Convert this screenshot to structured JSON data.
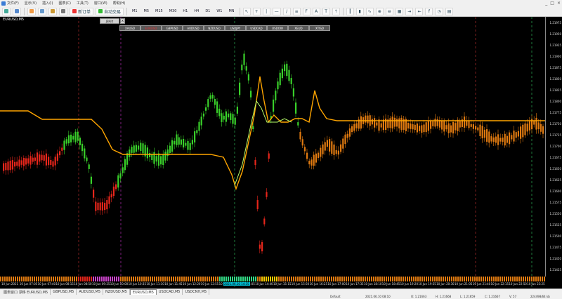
{
  "menu": {
    "items": [
      "文件(F)",
      "显示(V)",
      "插入(I)",
      "图表(C)",
      "工具(T)",
      "窗口(W)",
      "帮助(H)"
    ],
    "window_controls": [
      "_",
      "□",
      "×"
    ]
  },
  "toolbar": {
    "new_order_label": "新订单",
    "auto_trading_label": "自动交易",
    "timeframes": [
      "M1",
      "M5",
      "M15",
      "M30",
      "H1",
      "H4",
      "D1",
      "W1",
      "MN"
    ]
  },
  "chart": {
    "title": "EURUSD,M5",
    "symbol_tab": "JBAllt",
    "symbol_close": "x",
    "symbols": [
      "XAUSD",
      "EURUSD",
      "GBPUSD",
      "AUDUSD",
      "NZDUSD",
      "USDJPY",
      "USDCAD",
      "USDOW",
      "XEUD",
      "XTISD"
    ],
    "active_symbol": "EURUSD",
    "price_labels": [
      "1.21975",
      "1.21950",
      "1.21925",
      "1.21900",
      "1.21875",
      "1.21850",
      "1.21825",
      "1.21800",
      "1.21775",
      "1.21750",
      "1.21725",
      "1.21700",
      "1.21675",
      "1.21650",
      "1.21625",
      "1.21600",
      "1.21575",
      "1.21550",
      "1.21525",
      "1.21500",
      "1.21475",
      "1.21450",
      "1.21425"
    ],
    "time_labels": [
      "10 Jun 2021",
      "10 Jun 07:05",
      "10 Jun 07:40",
      "10 Jun 08:15",
      "10 Jun 08:50",
      "10 Jun 09:25",
      "10 Jun 10:00",
      "10 Jun 10:35",
      "10 Jun 11:10",
      "10 Jun 11:45",
      "10 Jun 12:20",
      "10 Jun 12:55",
      "10 Jun 13:30",
      "10 Jun 14:05",
      "10 Jun 14:40",
      "10 Jun 15:15",
      "10 Jun 15:50",
      "10 Jun 16:25",
      "10 Jun 17:00",
      "10 Jun 17:35",
      "10 Jun 18:10",
      "10 Jun 18:45",
      "10 Jun 19:20",
      "10 Jun 19:55",
      "10 Jun 20:30",
      "10 Jun 21:05",
      "10 Jun 21:40",
      "10 Jun 22:15",
      "10 Jun 22:50",
      "10 Jun 23:25"
    ],
    "highlighted_time": "2021.06.10 14:35",
    "colors": {
      "bull": "#39d02a",
      "bear": "#e8261b",
      "neutral": "#e07a10",
      "ma_line": "#ffa500",
      "vline_red": "#cc3333",
      "vline_magenta": "#cc33cc",
      "vline_green": "#33cc66"
    }
  },
  "tabs": [
    "图表窗口 漂移 EURUSD,M5",
    "GBPUSD,M5",
    "AUDUSD,M5",
    "NZDUSD,M5",
    "EURUSD,M5",
    "USDCAD,M5",
    "USDCNH,M5"
  ],
  "active_tab": "EURUSD,M5",
  "status": {
    "profile": "Default",
    "datetime": "2021.06.10 08:10",
    "open": "O: 1.21663",
    "high": "H: 1.21668",
    "low": "L: 1.21659",
    "close": "C: 1.21667",
    "volume": "V: 57",
    "traffic": "224498/64 kb"
  }
}
